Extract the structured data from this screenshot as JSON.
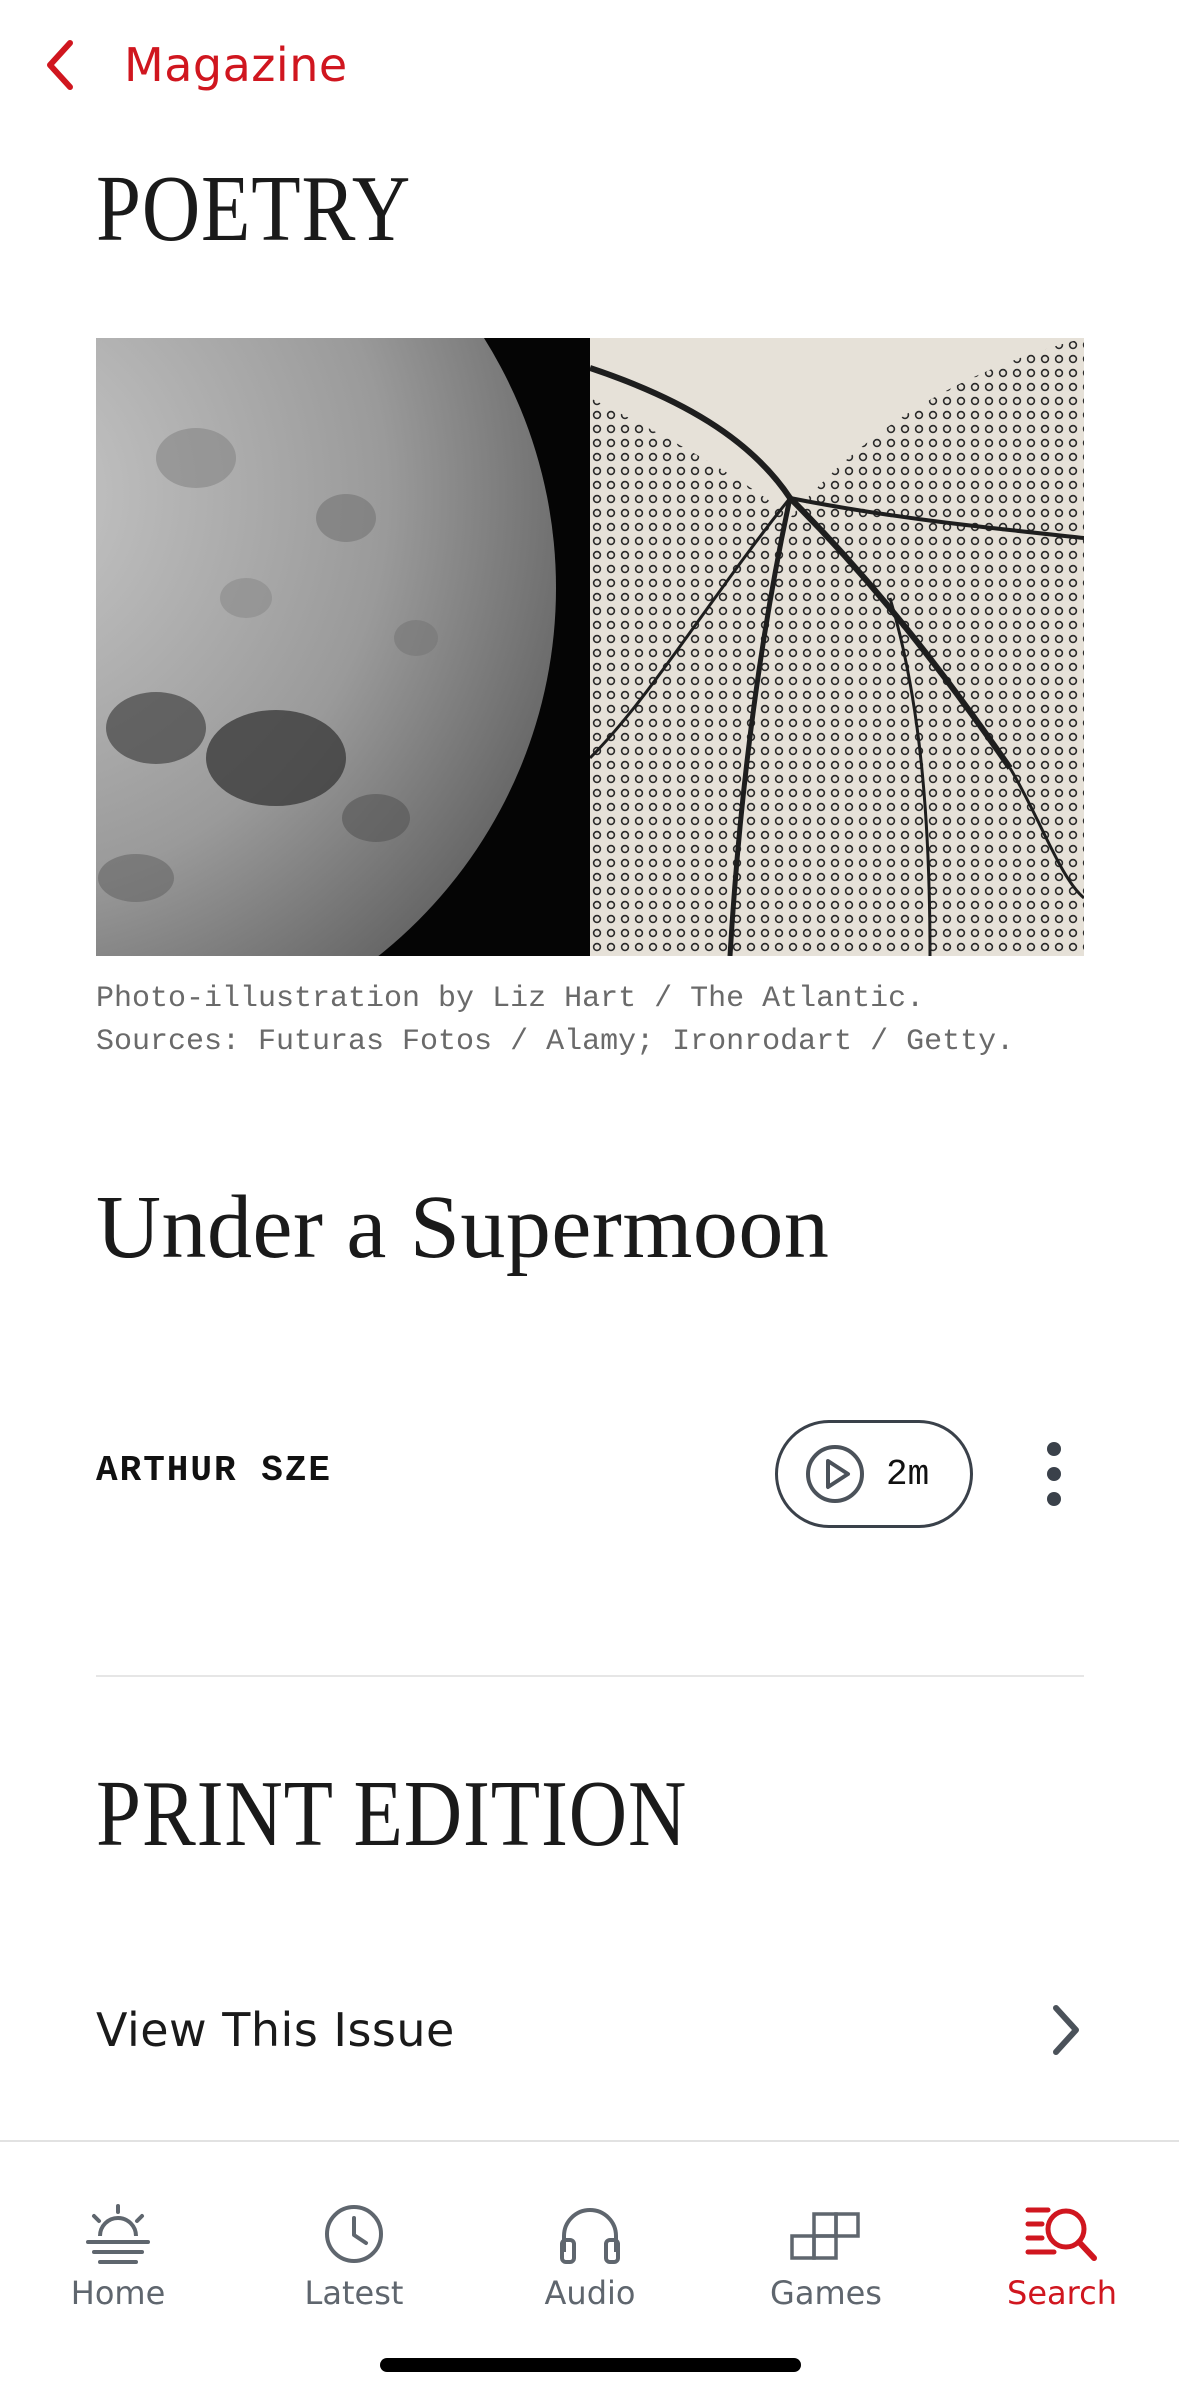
{
  "nav": {
    "back_label": "Magazine"
  },
  "section": {
    "title": "POETRY"
  },
  "hero": {
    "caption": "Photo-illustration by Liz Hart / The Atlantic. Sources: Futuras Fotos / Alamy; Ironrodart / Getty."
  },
  "article": {
    "title": "Under a Supermoon",
    "author": "ARTHUR SZE",
    "audio_duration": "2m"
  },
  "print_edition": {
    "title": "PRINT EDITION",
    "view_issue_label": "View This Issue"
  },
  "tabbar": {
    "items": [
      {
        "label": "Home",
        "icon": "sunrise-icon"
      },
      {
        "label": "Latest",
        "icon": "clock-icon"
      },
      {
        "label": "Audio",
        "icon": "headphones-icon"
      },
      {
        "label": "Games",
        "icon": "grid-blocks-icon"
      },
      {
        "label": "Search",
        "icon": "search-icon"
      }
    ],
    "active": "Search"
  },
  "colors": {
    "accent": "#d0161f",
    "icon_gray": "#5f666e",
    "text": "#1a1a1a"
  }
}
